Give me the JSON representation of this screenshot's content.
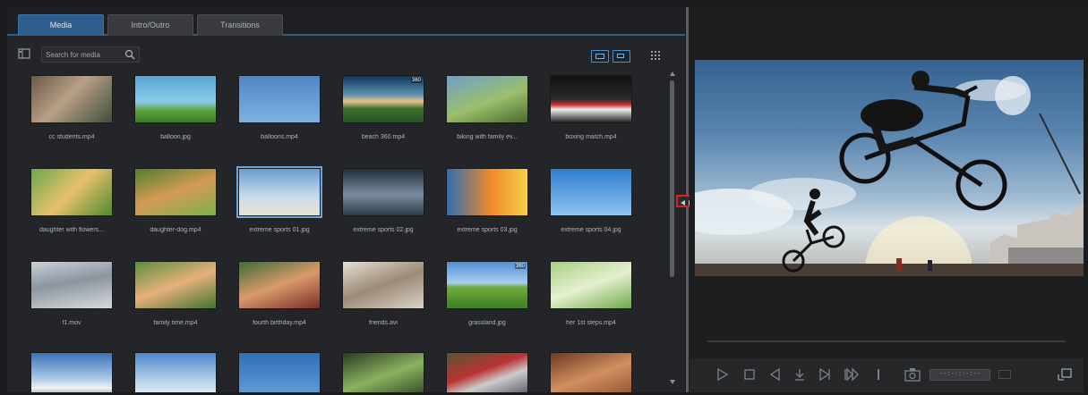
{
  "tabs": [
    {
      "label": "Media",
      "active": true
    },
    {
      "label": "Intro/Outro",
      "active": false
    },
    {
      "label": "Transitions",
      "active": false
    }
  ],
  "search": {
    "placeholder": "Search for media"
  },
  "media": [
    {
      "name": "cc students.mp4",
      "thumb": "students",
      "badge": ""
    },
    {
      "name": "balloon.jpg",
      "thumb": "balloon",
      "badge": ""
    },
    {
      "name": "balloons.mp4",
      "thumb": "sky",
      "badge": ""
    },
    {
      "name": "beach 360.mp4",
      "thumb": "beach",
      "badge": "360"
    },
    {
      "name": "biking with family ev...",
      "thumb": "biking",
      "badge": ""
    },
    {
      "name": "boxing match.mp4",
      "thumb": "boxing",
      "badge": ""
    },
    {
      "name": "daughter with flowers...",
      "thumb": "flowers",
      "badge": ""
    },
    {
      "name": "daughter-dog.mp4",
      "thumb": "dog",
      "badge": ""
    },
    {
      "name": "extreme sports 01.jpg",
      "thumb": "bike-sky",
      "badge": "",
      "selected": true
    },
    {
      "name": "extreme sports 02.jpg",
      "thumb": "bike-dark",
      "badge": ""
    },
    {
      "name": "extreme sports 03.jpg",
      "thumb": "sunset",
      "badge": ""
    },
    {
      "name": "extreme sports 04.jpg",
      "thumb": "skydive",
      "badge": ""
    },
    {
      "name": "f1.mov",
      "thumb": "f1",
      "badge": ""
    },
    {
      "name": "family time.mp4",
      "thumb": "family",
      "badge": ""
    },
    {
      "name": "fourth birthday.mp4",
      "thumb": "birthday",
      "badge": ""
    },
    {
      "name": "friends.avi",
      "thumb": "friends",
      "badge": ""
    },
    {
      "name": "grassland.jpg",
      "thumb": "grass",
      "badge": "360"
    },
    {
      "name": "her 1st steps.mp4",
      "thumb": "steps",
      "badge": ""
    },
    {
      "name": "",
      "thumb": "mountain",
      "badge": ""
    },
    {
      "name": "",
      "thumb": "snow",
      "badge": ""
    },
    {
      "name": "",
      "thumb": "blue",
      "badge": ""
    },
    {
      "name": "",
      "thumb": "magnify",
      "badge": ""
    },
    {
      "name": "",
      "thumb": "crowd",
      "badge": ""
    },
    {
      "name": "",
      "thumb": "food",
      "badge": ""
    }
  ],
  "preview": {
    "timecode": "--:--:--:--"
  },
  "icons": {
    "import": "import-media-icon",
    "search": "search-icon",
    "grid": "grid-view-icon",
    "play": "play-icon",
    "stop": "stop-icon",
    "prev": "previous-frame-icon",
    "mark": "mark-icon",
    "next": "next-frame-icon",
    "fast_forward": "fast-forward-icon",
    "snapshot": "snapshot-icon",
    "fit": "fit-view-icon"
  }
}
